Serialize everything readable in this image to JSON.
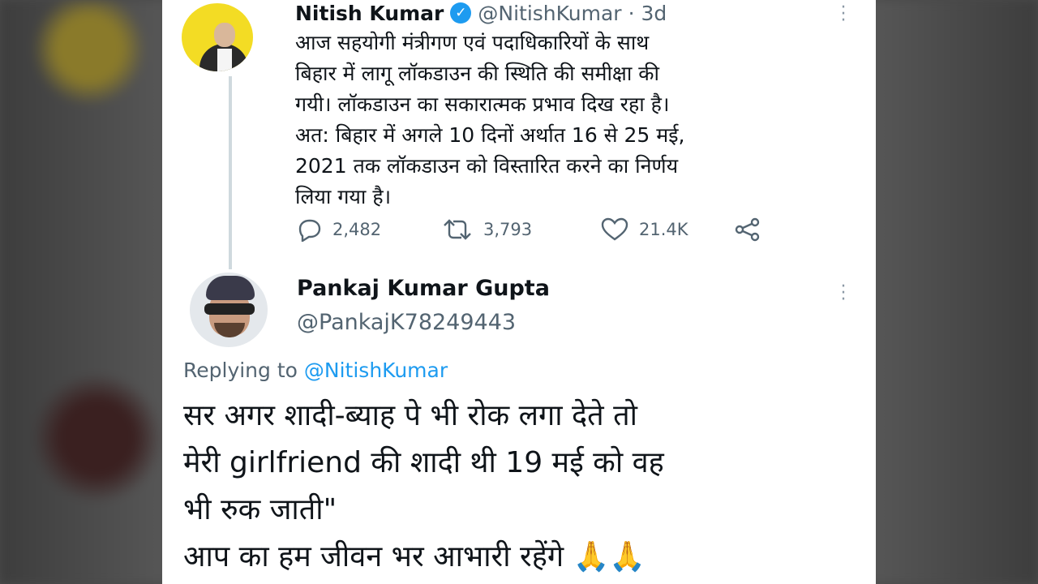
{
  "tweet": {
    "author_name": "Nitish Kumar",
    "verified_glyph": "✓",
    "handle": "@NitishKumar",
    "time": "· 3d",
    "text": "आज सहयोगी मंत्रीगण एवं पदाधिकारियों के साथ\nबिहार में लागू लॉकडाउन की स्थिति की समीक्षा की\nगयी। लॉकडाउन का सकारात्मक प्रभाव दिख रहा है।\nअत: बिहार में अगले 10 दिनों अर्थात 16 से 25 मई,\n2021 तक लॉकडाउन को विस्तारित करने का निर्णय\nलिया गया है।",
    "replies": "2,482",
    "retweets": "3,793",
    "likes": "21.4K",
    "icons": {
      "reply": "reply-icon",
      "retweet": "retweet-icon",
      "like": "heart-icon",
      "share": "share-icon",
      "more": "more-icon",
      "verified": "verified-badge-icon"
    }
  },
  "reply": {
    "author_name": "Pankaj Kumar Gupta",
    "handle": "@PankajK78249443",
    "replying_prefix": "Replying to",
    "replying_mention": "@NitishKumar",
    "text": "सर अगर शादी-ब्याह पे भी रोक लगा देते तो\nमेरी girlfriend की शादी थी 19 मई को वह\nभी रुक जाती\"\nआप का हम जीवन भर आभारी रहेंगे 🙏🙏"
  },
  "colors": {
    "verified": "#1d9bf0",
    "mention": "#1d9bf0",
    "secondary_text": "#536471",
    "avatar_bg": "#f3dc24"
  }
}
